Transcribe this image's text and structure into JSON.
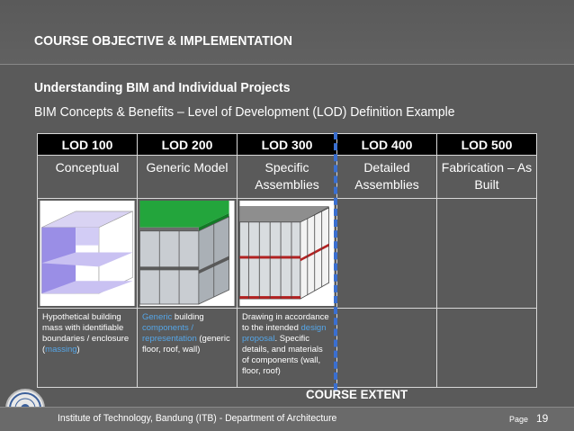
{
  "header": {
    "title": "COURSE OBJECTIVE & IMPLEMENTATION",
    "subtitle": "Understanding BIM and Individual Projects",
    "subtitle2": "BIM Concepts & Benefits – Level of Development (LOD) Definition Example"
  },
  "table": {
    "headers": [
      "LOD 100",
      "LOD 200",
      "LOD 300",
      "LOD 400",
      "LOD 500"
    ],
    "descriptions": [
      [
        "Conceptual"
      ],
      [
        "Generic Model"
      ],
      [
        "Specific",
        "Assemblies"
      ],
      [
        "Detailed",
        "Assemblies"
      ],
      [
        "Fabrication – As",
        "Built"
      ]
    ],
    "notes": {
      "lod100": {
        "a": "Hypothetical building mass with identifiable boundaries / enclosure (",
        "b": "massing",
        "c": ")"
      },
      "lod200": {
        "a": "Generic",
        "b": " building ",
        "c": "components / representation",
        "d": " (generic floor, roof, wall)"
      },
      "lod300": {
        "a": "Drawing in accordance to the intended ",
        "b": "design proposal",
        "c": ". Specific details, and materials of components (wall, floor, roof)"
      }
    }
  },
  "course_extent": "COURSE EXTENT",
  "footer": {
    "institution": "Institute of Technology, Bandung (ITB) - Department of Architecture",
    "page_label": "Page",
    "page_number": "19"
  },
  "colors": {
    "background": "#5a5a5a",
    "header_cell": "#000000",
    "highlight": "#55a6e8",
    "course_line": "#3a6fd0",
    "roof_green": "#1aa53a"
  }
}
